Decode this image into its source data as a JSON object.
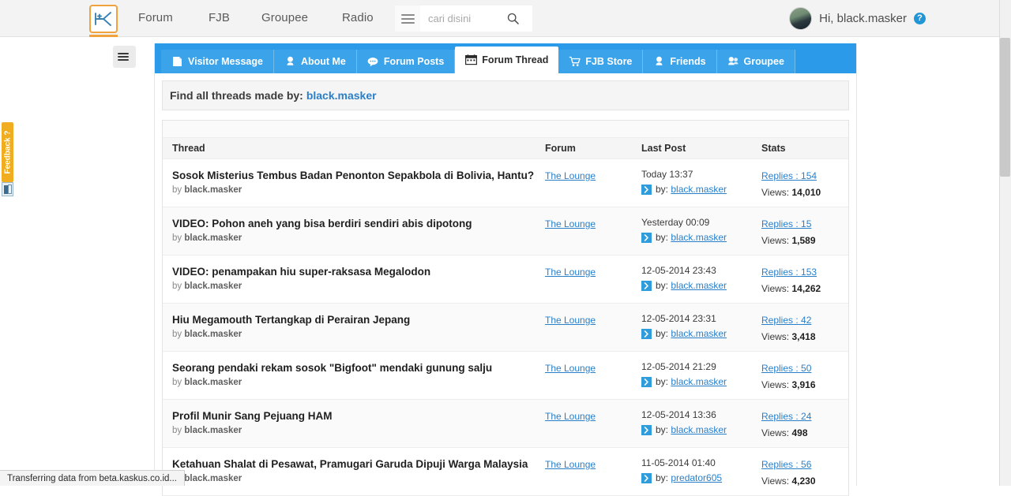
{
  "header": {
    "logo_alt": "kaskus-logo",
    "nav": [
      {
        "label": "Forum",
        "name": "nav-forum"
      },
      {
        "label": "FJB",
        "name": "nav-fjb"
      },
      {
        "label": "Groupee",
        "name": "nav-groupee"
      },
      {
        "label": "Radio",
        "name": "nav-radio"
      }
    ],
    "search": {
      "value": "",
      "placeholder": "cari disini"
    },
    "user": {
      "greeting": "Hi, black.masker",
      "help_badge": "?"
    },
    "accent_orange": "#f0a23c",
    "accent_blue": "#2b9ae8"
  },
  "feedback": {
    "label": "Feedback ?"
  },
  "tabs": [
    {
      "label": "Visitor Message",
      "icon": "page-icon",
      "active": false
    },
    {
      "label": "About Me",
      "icon": "person-icon",
      "active": false
    },
    {
      "label": "Forum Posts",
      "icon": "speech-bubble-icon",
      "active": false
    },
    {
      "label": "Forum Thread",
      "icon": "calendar-icon",
      "active": true
    },
    {
      "label": "FJB Store",
      "icon": "cart-icon",
      "active": false
    },
    {
      "label": "Friends",
      "icon": "person-icon",
      "active": false
    },
    {
      "label": "Groupee",
      "icon": "people-icon",
      "active": false
    }
  ],
  "find_bar": {
    "prefix": "Find all threads made by:",
    "username": "black.masker"
  },
  "table": {
    "columns": [
      "Thread",
      "Forum",
      "Last Post",
      "Stats"
    ],
    "rows": [
      {
        "title": "Sosok Misterius Tembus Badan Penonton Sepakbola di Bolivia, Hantu?",
        "by_prefix": "by",
        "by_user": "black.masker",
        "forum": "The Lounge",
        "last_date": "Today 13:37",
        "last_by_prefix": "by:",
        "last_by_user": "black.masker",
        "replies_label": "Replies :",
        "replies": "154",
        "views_label": "Views:",
        "views": "14,010"
      },
      {
        "title": "VIDEO: Pohon aneh yang bisa berdiri sendiri abis dipotong",
        "by_prefix": "by",
        "by_user": "black.masker",
        "forum": "The Lounge",
        "last_date": "Yesterday 00:09",
        "last_by_prefix": "by:",
        "last_by_user": "black.masker",
        "replies_label": "Replies :",
        "replies": "15",
        "views_label": "Views:",
        "views": "1,589"
      },
      {
        "title": "VIDEO: penampakan hiu super-raksasa Megalodon",
        "by_prefix": "by",
        "by_user": "black.masker",
        "forum": "The Lounge",
        "last_date": "12-05-2014 23:43",
        "last_by_prefix": "by:",
        "last_by_user": "black.masker",
        "replies_label": "Replies :",
        "replies": "153",
        "views_label": "Views:",
        "views": "14,262"
      },
      {
        "title": "Hiu Megamouth Tertangkap di Perairan Jepang",
        "by_prefix": "by",
        "by_user": "black.masker",
        "forum": "The Lounge",
        "last_date": "12-05-2014 23:31",
        "last_by_prefix": "by:",
        "last_by_user": "black.masker",
        "replies_label": "Replies :",
        "replies": "42",
        "views_label": "Views:",
        "views": "3,418"
      },
      {
        "title": "Seorang pendaki rekam sosok \"Bigfoot\" mendaki gunung salju",
        "by_prefix": "by",
        "by_user": "black.masker",
        "forum": "The Lounge",
        "last_date": "12-05-2014 21:29",
        "last_by_prefix": "by:",
        "last_by_user": "black.masker",
        "replies_label": "Replies :",
        "replies": "50",
        "views_label": "Views:",
        "views": "3,916"
      },
      {
        "title": "Profil Munir Sang Pejuang HAM",
        "by_prefix": "by",
        "by_user": "black.masker",
        "forum": "The Lounge",
        "last_date": "12-05-2014 13:36",
        "last_by_prefix": "by:",
        "last_by_user": "black.masker",
        "replies_label": "Replies :",
        "replies": "24",
        "views_label": "Views:",
        "views": "498"
      },
      {
        "title": "Ketahuan Shalat di Pesawat, Pramugari Garuda Dipuji Warga Malaysia",
        "by_prefix": "by",
        "by_user": "black.masker",
        "forum": "The Lounge",
        "last_date": "11-05-2014 01:40",
        "last_by_prefix": "by:",
        "last_by_user": "predator605",
        "replies_label": "Replies :",
        "replies": "56",
        "views_label": "Views:",
        "views": "4,230"
      }
    ]
  },
  "status_bar": {
    "text": "Transferring data from beta.kaskus.co.id..."
  }
}
